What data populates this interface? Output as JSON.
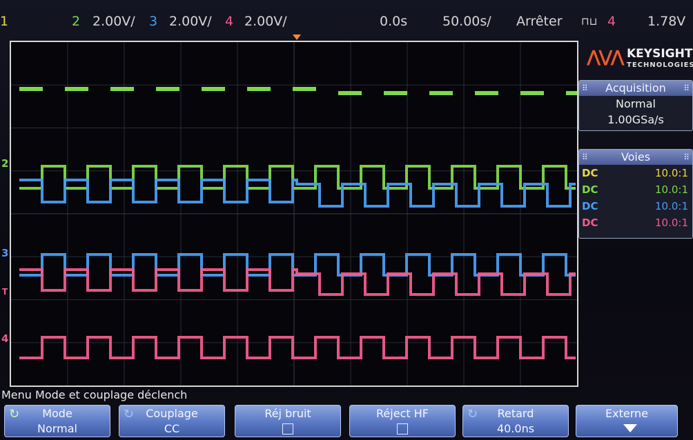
{
  "topbar": {
    "ch1_label": "1",
    "ch2_label": "2",
    "ch2_scale": "2.00V/",
    "ch3_label": "3",
    "ch3_scale": "2.00V/",
    "ch4_label": "4",
    "ch4_scale": "2.00V/",
    "time_delay": "0.0s",
    "time_base": "50.00s/",
    "run_state": "Arrêter",
    "trigger_edge": "⊓⊔",
    "trigger_source": "4",
    "trigger_level": "1.78V"
  },
  "markers": {
    "ch2": "2",
    "ch3": "3",
    "trigger": "T",
    "ch4": "4"
  },
  "logo": {
    "brand": "KEYSIGHT",
    "sub": "TECHNOLOGIES"
  },
  "acquisition": {
    "title": "Acquisition",
    "mode": "Normal",
    "rate": "1.00GSa/s"
  },
  "voies": {
    "title": "Voies",
    "rows": [
      {
        "coupling": "DC",
        "probe": "10.0:1",
        "color": "#e8d84a"
      },
      {
        "coupling": "DC",
        "probe": "10.0:1",
        "color": "#7fd84a"
      },
      {
        "coupling": "DC",
        "probe": "10.0:1",
        "color": "#4a9cf0"
      },
      {
        "coupling": "DC",
        "probe": "10.0:1",
        "color": "#f05c8a"
      }
    ]
  },
  "menu": {
    "title": "Menu Mode et couplage déclench",
    "softkeys": [
      {
        "line1": "Mode",
        "line2": "Normal"
      },
      {
        "line1": "Couplage",
        "line2": "CC"
      },
      {
        "line1": "Réj bruit",
        "line2": ""
      },
      {
        "line1": "Réject HF",
        "line2": ""
      },
      {
        "line1": "Retard",
        "line2": "40.0ns"
      },
      {
        "line1": "Externe",
        "line2": ""
      }
    ]
  },
  "colors": {
    "ch1": "#e8d84a",
    "ch2": "#7fd84a",
    "ch3": "#4a9cf0",
    "ch4": "#f05c8a",
    "trigger_marker": "#f08a3a",
    "brand_wave": "#f05a2a"
  }
}
